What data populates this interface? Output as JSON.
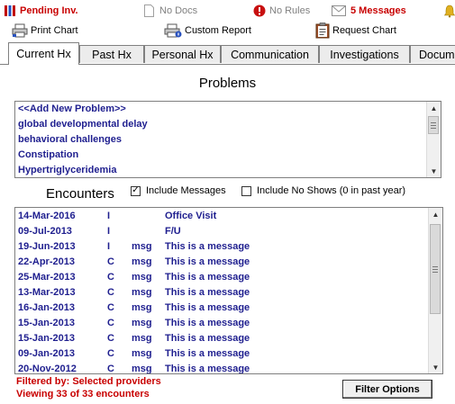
{
  "status_bar": {
    "pending": "Pending Inv.",
    "no_docs": "No Docs",
    "no_rules": "No Rules",
    "messages": "5 Messages"
  },
  "toolbar": {
    "print_chart": "Print Chart",
    "custom_report": "Custom Report",
    "request_chart": "Request Chart"
  },
  "tabs": [
    {
      "label": "Current Hx",
      "active": true
    },
    {
      "label": "Past Hx"
    },
    {
      "label": "Personal Hx"
    },
    {
      "label": "Communication"
    },
    {
      "label": "Investigations"
    },
    {
      "label": "Docum"
    }
  ],
  "problems": {
    "title": "Problems",
    "items": [
      "<<Add New Problem>>",
      "global developmental  delay",
      "behavioral challenges",
      "Constipation",
      "Hypertriglyceridemia"
    ]
  },
  "encounters": {
    "title": "Encounters",
    "include_messages": {
      "label": "Include Messages",
      "checked": true
    },
    "include_no_shows": {
      "label": "Include No Shows (0 in past year)",
      "checked": false
    },
    "rows": [
      {
        "date": "14-Mar-2016",
        "type": "I",
        "tag": "",
        "description": "Office Visit"
      },
      {
        "date": "09-Jul-2013",
        "type": "I",
        "tag": "",
        "description": "F/U"
      },
      {
        "date": "19-Jun-2013",
        "type": "I",
        "tag": "msg",
        "description": "This is a message"
      },
      {
        "date": "22-Apr-2013",
        "type": "C",
        "tag": "msg",
        "description": "This is a message"
      },
      {
        "date": "25-Mar-2013",
        "type": "C",
        "tag": "msg",
        "description": "This is a message"
      },
      {
        "date": "13-Mar-2013",
        "type": "C",
        "tag": "msg",
        "description": "This is a message"
      },
      {
        "date": "16-Jan-2013",
        "type": "C",
        "tag": "msg",
        "description": "This is a message"
      },
      {
        "date": "15-Jan-2013",
        "type": "C",
        "tag": "msg",
        "description": "This is a message"
      },
      {
        "date": "15-Jan-2013",
        "type": "C",
        "tag": "msg",
        "description": "This is a message"
      },
      {
        "date": "09-Jan-2013",
        "type": "C",
        "tag": "msg",
        "description": "This is a message"
      },
      {
        "date": "20-Nov-2012",
        "type": "C",
        "tag": "msg",
        "description": "This is a message"
      }
    ]
  },
  "footer": {
    "filtered_by": "Filtered by: Selected providers",
    "viewing": "Viewing 33 of 33 encounters",
    "filter_button": "Filter Options"
  },
  "colors": {
    "status_red": "#c80000",
    "list_text_navy": "#1f1f8f",
    "tab_border": "#808080"
  }
}
